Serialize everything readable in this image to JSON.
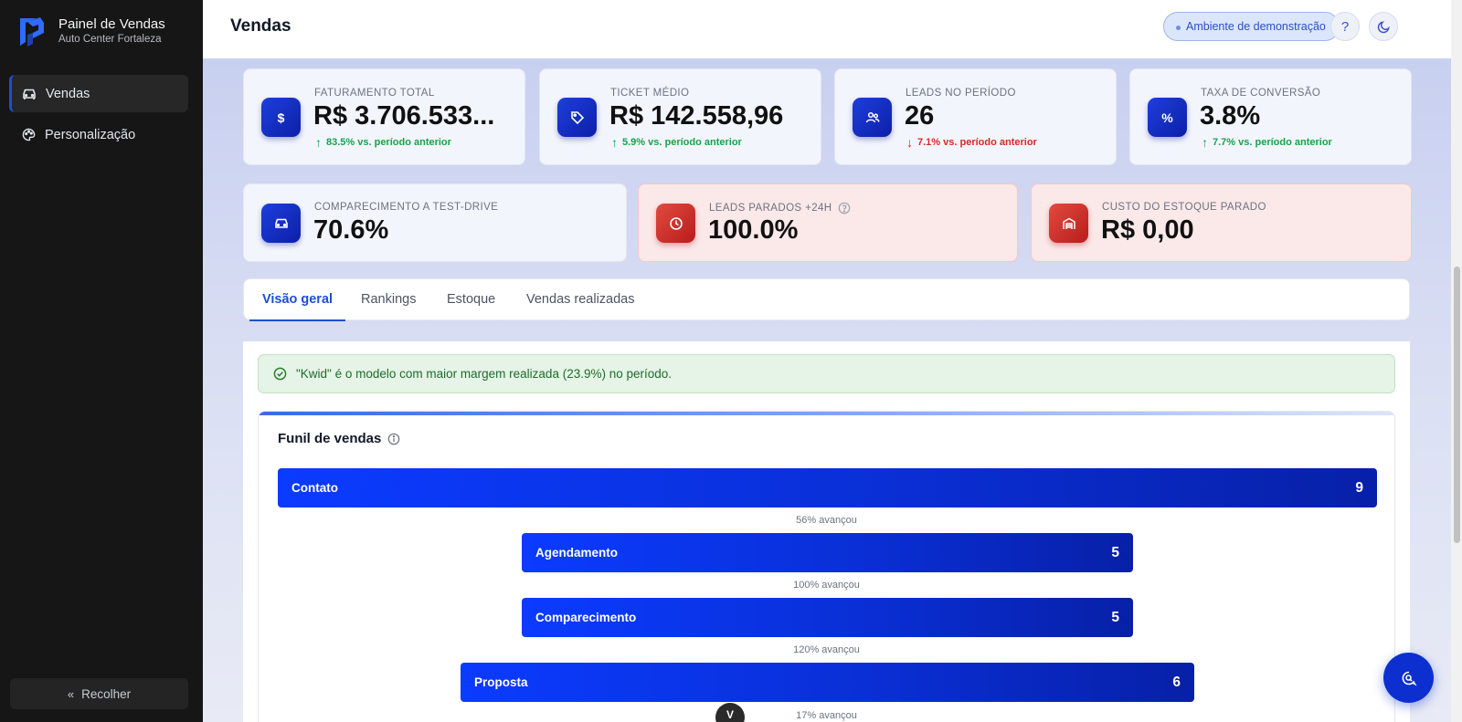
{
  "app": {
    "title": "Painel de Vendas",
    "subtitle": "Auto Center Fortaleza"
  },
  "sidebar": {
    "items": [
      {
        "label": "Vendas",
        "icon": "car-icon",
        "active": true
      },
      {
        "label": "Personalização",
        "icon": "palette-icon",
        "active": false
      }
    ],
    "collapse_label": "Recolher"
  },
  "header": {
    "title": "Vendas",
    "demo_badge": "Ambiente de demonstração",
    "help_icon": "question-icon",
    "theme_icon": "moon-icon"
  },
  "kpis_row1": [
    {
      "label": "Faturamento total",
      "value": "R$ 3.706.533...",
      "delta": "83.5% vs. período anterior",
      "direction": "up",
      "icon": "dollar-icon"
    },
    {
      "label": "Ticket médio",
      "value": "R$ 142.558,96",
      "delta": "5.9% vs. período anterior",
      "direction": "up",
      "icon": "tag-icon"
    },
    {
      "label": "Leads no período",
      "value": "26",
      "delta": "7.1% vs. período anterior",
      "direction": "down",
      "icon": "users-icon"
    },
    {
      "label": "Taxa de conversão",
      "value": "3.8%",
      "delta": "7.7% vs. período anterior",
      "direction": "up",
      "icon": "percent-icon"
    }
  ],
  "kpis_row2": [
    {
      "label": "Comparecimento a test-drive",
      "value": "70.6%",
      "icon": "car-icon",
      "alert": false
    },
    {
      "label": "Leads parados +24h",
      "value": "100.0%",
      "icon": "clock-icon",
      "alert": true
    },
    {
      "label": "Custo do estoque parado",
      "value": "R$ 0,00",
      "icon": "warehouse-icon",
      "alert": true
    }
  ],
  "tabs": [
    {
      "label": "Visão geral",
      "active": true
    },
    {
      "label": "Rankings",
      "active": false
    },
    {
      "label": "Estoque",
      "active": false
    },
    {
      "label": "Vendas realizadas",
      "active": false
    }
  ],
  "insight": "\"Kwid\" é o modelo com maior margem realizada (23.9%) no período.",
  "funnel": {
    "title": "Funil de vendas",
    "stages": [
      {
        "label": "Contato",
        "value": 9
      },
      {
        "label": "Agendamento",
        "value": 5
      },
      {
        "label": "Comparecimento",
        "value": 5
      },
      {
        "label": "Proposta",
        "value": 6
      }
    ],
    "conversions": [
      "56% avançou",
      "100% avançou",
      "120% avançou",
      "17% avançou"
    ]
  },
  "colors": {
    "accent": "#1d4ed8",
    "sidebar_bg": "#161616",
    "bar_start": "#0b3bff",
    "bar_end": "#0720a8",
    "up": "#16a34a",
    "down": "#dc2626"
  }
}
